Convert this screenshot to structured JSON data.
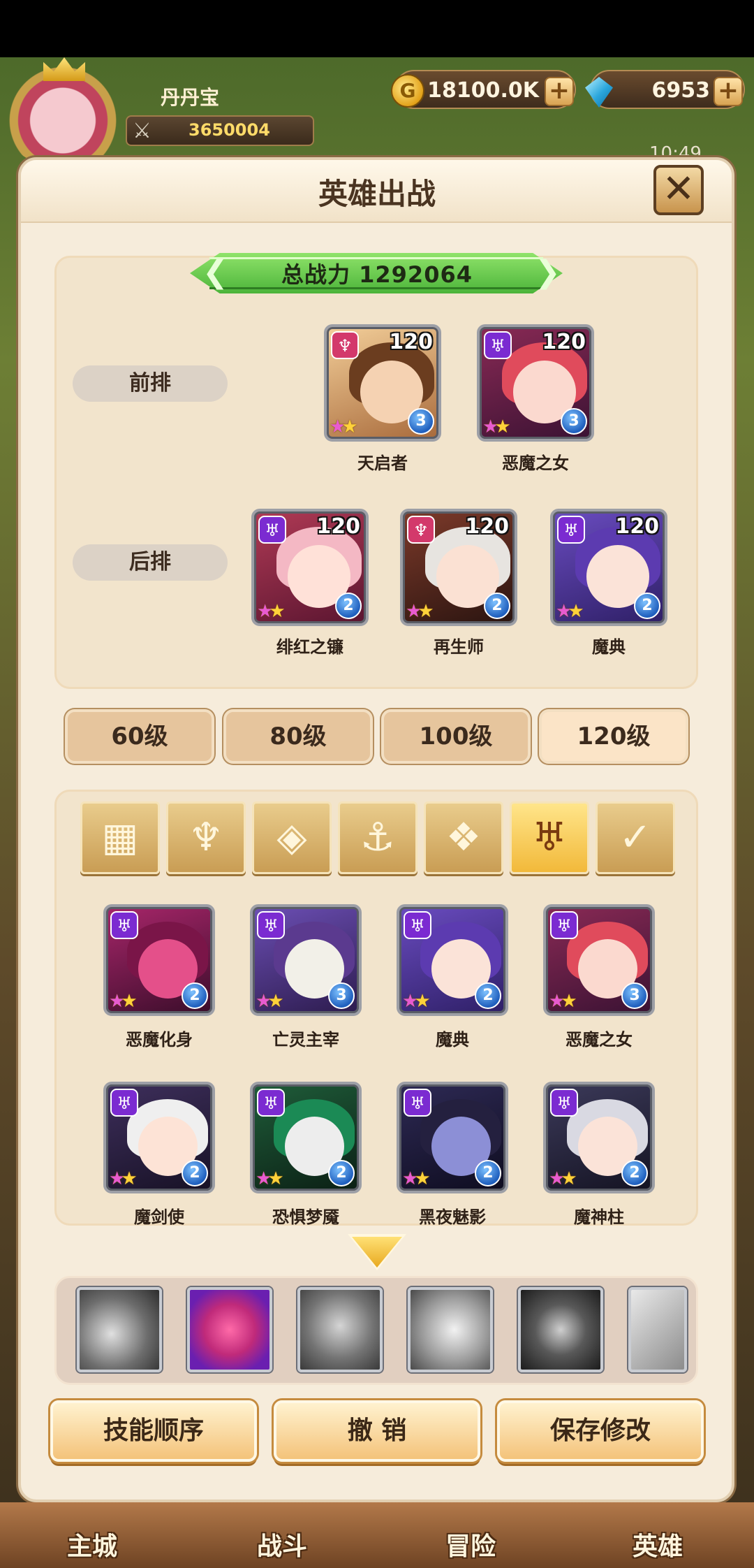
{
  "hud": {
    "player_name": "丹丹宝",
    "combat_power": "3650004",
    "gold": "18100.0K",
    "gems": "6953",
    "time": "10:49",
    "coin_symbol": "G",
    "plus": "+"
  },
  "panel": {
    "title": "英雄出战",
    "close": "✕",
    "total_power_label": "总战力    1292064"
  },
  "formation": {
    "front_label": "前排",
    "back_label": "后排",
    "front": [
      {
        "name": "天启者",
        "level": "120",
        "stars": 2,
        "badge": "3",
        "faction": "pink"
      },
      {
        "name": "恶魔之女",
        "level": "120",
        "stars": 2,
        "badge": "3",
        "faction": "purple"
      }
    ],
    "back": [
      {
        "name": "绯红之镰",
        "level": "120",
        "stars": 2,
        "badge": "2",
        "faction": "purple"
      },
      {
        "name": "再生师",
        "level": "120",
        "stars": 2,
        "badge": "2",
        "faction": "pink"
      },
      {
        "name": "魔典",
        "level": "120",
        "stars": 2,
        "badge": "2",
        "faction": "purple"
      }
    ]
  },
  "level_tabs": [
    "60级",
    "80级",
    "100级",
    "120级"
  ],
  "active_level_tab": 3,
  "faction_filters": [
    {
      "icon": "grid-icon",
      "glyph": "▦"
    },
    {
      "icon": "leaf-icon",
      "glyph": "♆"
    },
    {
      "icon": "diamond-icon",
      "glyph": "◈"
    },
    {
      "icon": "anchor-icon",
      "glyph": "⚓"
    },
    {
      "icon": "beast-icon",
      "glyph": "❖"
    },
    {
      "icon": "demon-horn-icon",
      "glyph": "♅"
    },
    {
      "icon": "wing-icon",
      "glyph": "✓"
    }
  ],
  "active_filter": 5,
  "roster": [
    {
      "name": "恶魔化身",
      "badge": "2",
      "stars": 2
    },
    {
      "name": "亡灵主宰",
      "badge": "3",
      "stars": 2
    },
    {
      "name": "魔典",
      "badge": "2",
      "stars": 2
    },
    {
      "name": "恶魔之女",
      "badge": "3",
      "stars": 2
    },
    {
      "name": "魔剑使",
      "badge": "2",
      "stars": 2
    },
    {
      "name": "恐惧梦魇",
      "badge": "2",
      "stars": 2
    },
    {
      "name": "黑夜魅影",
      "badge": "2",
      "stars": 2
    },
    {
      "name": "魔神柱",
      "badge": "2",
      "stars": 2
    }
  ],
  "actions": {
    "skill_order": "技能顺序",
    "undo": "撤 销",
    "save": "保存修改"
  },
  "nav": {
    "city": "主城",
    "battle": "战斗",
    "adventure": "冒险",
    "hero": "英雄"
  }
}
